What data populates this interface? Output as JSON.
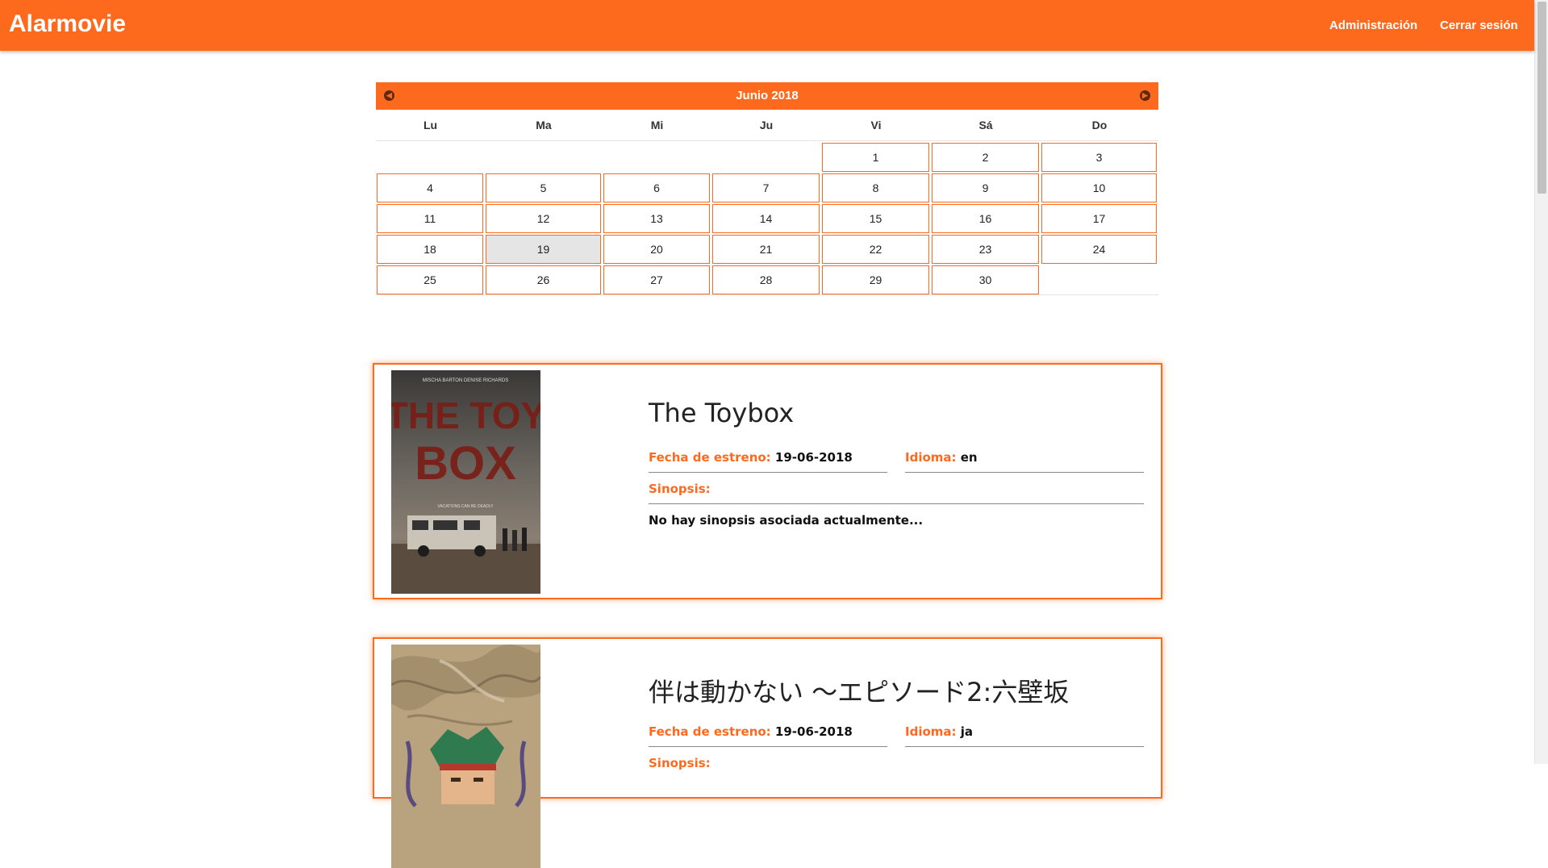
{
  "header": {
    "brand": "Alarmovie",
    "nav": {
      "admin": "Administración",
      "logout": "Cerrar sesión"
    },
    "color": "#fd6a1e"
  },
  "calendar": {
    "month_label": "Junio 2018",
    "prev_icon": "chevron-left-icon",
    "next_icon": "chevron-right-icon",
    "weekdays": [
      "Lu",
      "Ma",
      "Mi",
      "Ju",
      "Vi",
      "Sá",
      "Do"
    ],
    "weeks": [
      [
        "",
        "",
        "",
        "",
        "1",
        "2",
        "3"
      ],
      [
        "4",
        "5",
        "6",
        "7",
        "8",
        "9",
        "10"
      ],
      [
        "11",
        "12",
        "13",
        "14",
        "15",
        "16",
        "17"
      ],
      [
        "18",
        "19",
        "20",
        "21",
        "22",
        "23",
        "24"
      ],
      [
        "25",
        "26",
        "27",
        "28",
        "29",
        "30",
        ""
      ]
    ],
    "selected_day": "19"
  },
  "labels": {
    "release": "Fecha de estreno:",
    "language": "Idioma:",
    "synopsis": "Sinopsis:"
  },
  "movies": [
    {
      "title": "The Toybox",
      "release_date": "19-06-2018",
      "language": "en",
      "synopsis": "No hay sinopsis asociada actualmente...",
      "poster": {
        "top_text": "MISCHA BARTON   DENISE RICHARDS",
        "title_line1": "THE TOY",
        "title_line2": "BOX",
        "tagline": "VACATIONS CAN BE DEADLY"
      }
    },
    {
      "title": "伴は動かない ～エピソード2:六壁坂",
      "release_date": "19-06-2018",
      "language": "ja",
      "synopsis": ""
    }
  ]
}
